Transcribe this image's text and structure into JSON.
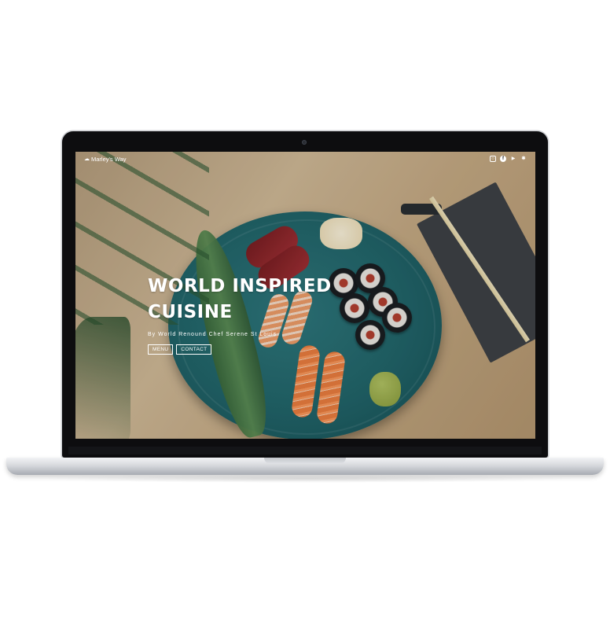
{
  "site": {
    "logo_text": "Marley's Way",
    "logo_icon": "chef-hat-icon"
  },
  "social": [
    {
      "name": "instagram-icon",
      "glyph": "◎"
    },
    {
      "name": "facebook-icon",
      "glyph": "f"
    },
    {
      "name": "twitter-icon",
      "glyph": "🐦"
    },
    {
      "name": "yelp-icon",
      "glyph": "✱"
    }
  ],
  "hero": {
    "title_line1": "WORLD INSPIRED",
    "title_line2": "CUISINE",
    "subtitle": "By World Renound Chef Serene St Louis",
    "menu_button": "MENU",
    "contact_button": "CONTACT"
  }
}
